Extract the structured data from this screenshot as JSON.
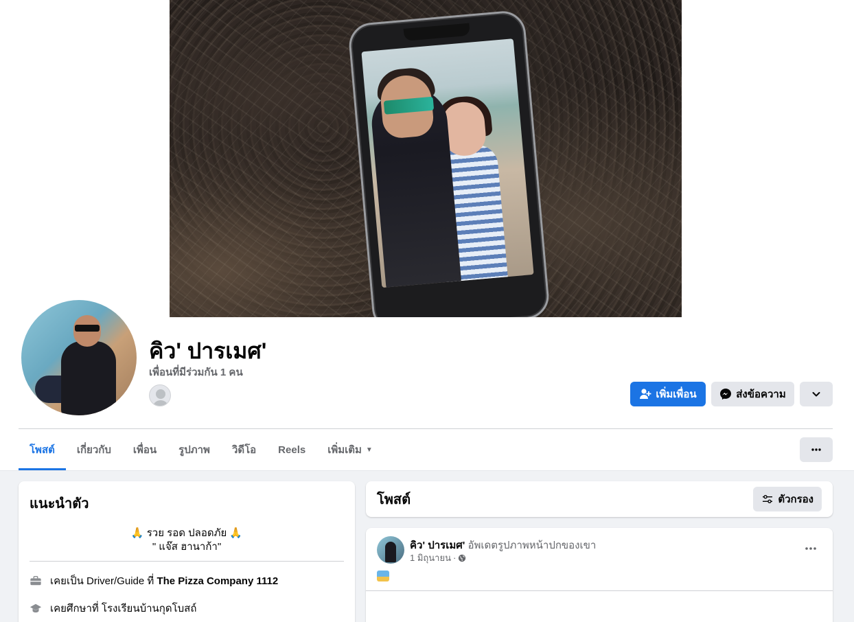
{
  "profile": {
    "name": "คิว' ปารเมศ'",
    "mutual_friends": "เพื่อนที่มีร่วมกัน 1 คน"
  },
  "actions": {
    "add_friend": "เพิ่มเพื่อน",
    "message": "ส่งข้อความ"
  },
  "tabs": [
    {
      "label": "โพสต์"
    },
    {
      "label": "เกี่ยวกับ"
    },
    {
      "label": "เพื่อน"
    },
    {
      "label": "รูปภาพ"
    },
    {
      "label": "วิดีโอ"
    },
    {
      "label": "Reels"
    },
    {
      "label": "เพิ่มเติม"
    }
  ],
  "intro": {
    "title": "แนะนำตัว",
    "bio_line1": "🙏 รวย รอด ปลอดภัย 🙏",
    "bio_line2": "\" แจ๊ส ฮานาก้า\"",
    "work_prefix": "เคยเป็น Driver/Guide ที่",
    "work_place": "The Pizza Company 1112",
    "education": "เคยศึกษาที่ โรงเรียนบ้านกุดโบสถ์"
  },
  "posts": {
    "title": "โพสต์",
    "filter_label": "ตัวกรอง"
  },
  "post": {
    "author": "คิว' ปารเมศ'",
    "action": "อัพเดตรูปภาพหน้าปกของเขา",
    "date": "1 มิถุนายน",
    "separator": "·"
  },
  "colors": {
    "accent": "#1b74e4",
    "secondary_button": "#e4e6eb",
    "feed_background": "#f0f2f5"
  }
}
